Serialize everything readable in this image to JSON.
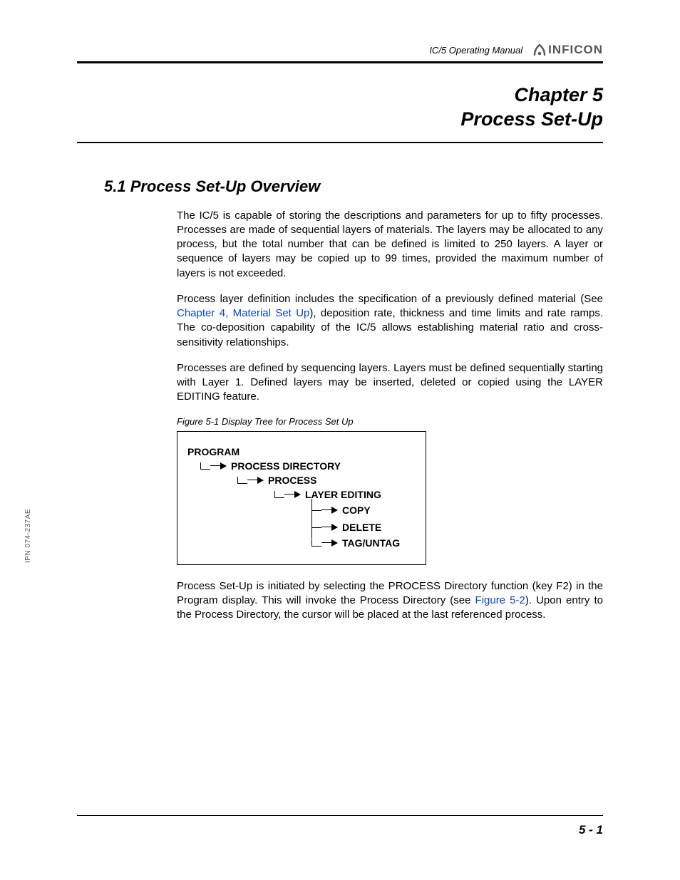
{
  "header": {
    "manual_title": "IC/5 Operating Manual",
    "brand": "INFICON"
  },
  "chapter": {
    "line1": "Chapter 5",
    "line2": "Process Set-Up"
  },
  "section_heading": "5.1  Process Set-Up Overview",
  "paragraphs": {
    "p1": "The IC/5 is capable of storing the descriptions and parameters for up to fifty processes. Processes are made of sequential layers of materials. The layers may be allocated to any process, but the total number that can be defined is limited to 250 layers. A layer or sequence of layers may be copied up to 99 times, provided the maximum number of layers is not exceeded.",
    "p2a": "Process layer definition includes the specification of a previously defined material (See ",
    "p2_link": "Chapter 4, Material Set Up",
    "p2b": "), deposition rate, thickness and time limits and rate ramps. The co-deposition capability of the IC/5 allows establishing material ratio and cross-sensitivity relationships.",
    "p3": "Processes are defined by sequencing layers. Layers must be defined sequentially starting with Layer 1. Defined layers may be inserted, deleted or copied using the LAYER EDITING feature.",
    "p4a": "Process Set-Up is initiated by selecting the PROCESS Directory function (key F2) in the Program display. This will invoke the Process Directory (see ",
    "p4_link": "Figure 5-2",
    "p4b": "). Upon entry to the Process Directory, the cursor will be placed at the last referenced process."
  },
  "figure": {
    "caption": "Figure 5-1  Display Tree for Process Set Up",
    "tree": {
      "n0": "PROGRAM",
      "n1": "PROCESS DIRECTORY",
      "n2": "PROCESS",
      "n3": "LAYER EDITING",
      "n4": "COPY",
      "n5": "DELETE",
      "n6": "TAG/UNTAG"
    }
  },
  "side_label": "IPN 074-237AE",
  "page_number": "5 - 1"
}
